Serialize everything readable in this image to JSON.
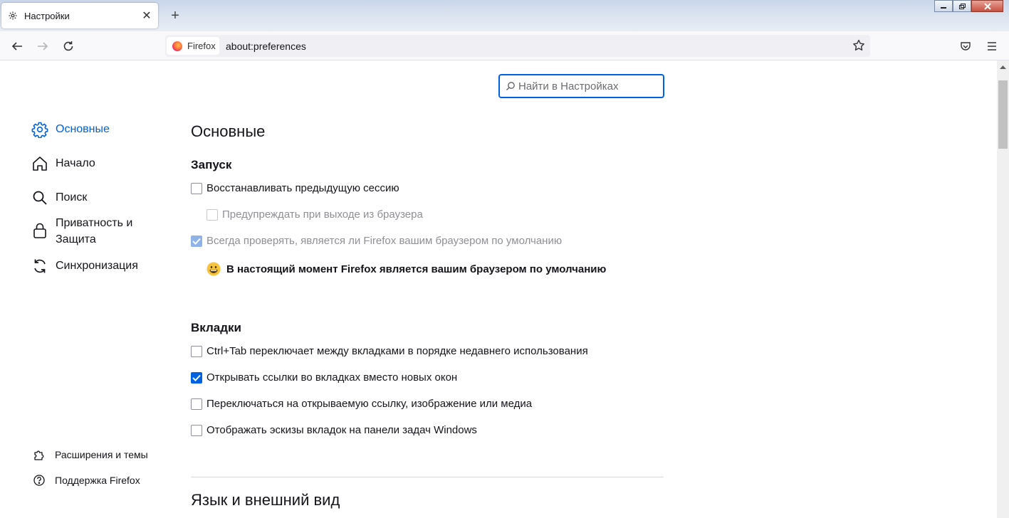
{
  "tab": {
    "title": "Настройки",
    "close_glyph": "✕",
    "icon": "gear-icon"
  },
  "newtab_glyph": "+",
  "nav": {
    "identity_label": "Firefox",
    "url": "about:preferences"
  },
  "search": {
    "placeholder": "Найти в Настройках",
    "value": ""
  },
  "sidebar": {
    "items": [
      {
        "label": "Основные",
        "icon": "gear-icon",
        "active": true
      },
      {
        "label": "Начало",
        "icon": "home-icon"
      },
      {
        "label": "Поиск",
        "icon": "search-icon"
      },
      {
        "label": "Приватность и Защита",
        "icon": "lock-icon"
      },
      {
        "label": "Синхронизация",
        "icon": "sync-icon"
      }
    ],
    "footer": [
      {
        "label": "Расширения и темы",
        "icon": "puzzle-icon"
      },
      {
        "label": "Поддержка Firefox",
        "icon": "help-icon"
      }
    ]
  },
  "main": {
    "title": "Основные",
    "startup": {
      "heading": "Запуск",
      "options": [
        {
          "label": "Восстанавливать предыдущую сессию",
          "checked": false,
          "disabled": false
        },
        {
          "label": "Предупреждать при выходе из браузера",
          "checked": false,
          "disabled": true
        },
        {
          "label": "Всегда проверять, является ли Firefox вашим браузером по умолчанию",
          "checked": true,
          "disabled": true
        }
      ],
      "default_note": "В настоящий момент Firefox является вашим браузером по умолчанию"
    },
    "tabs": {
      "heading": "Вкладки",
      "options": [
        {
          "label": "Ctrl+Tab переключает между вкладками в порядке недавнего использования",
          "checked": false
        },
        {
          "label": "Открывать ссылки во вкладках вместо новых окон",
          "checked": true
        },
        {
          "label": "Переключаться на открываемую ссылку, изображение или медиа",
          "checked": false
        },
        {
          "label": "Отображать эскизы вкладок на панели задач Windows",
          "checked": false
        }
      ]
    },
    "language_heading": "Язык и внешний вид"
  },
  "colors": {
    "accent": "#0061e0",
    "text": "#15141a"
  }
}
